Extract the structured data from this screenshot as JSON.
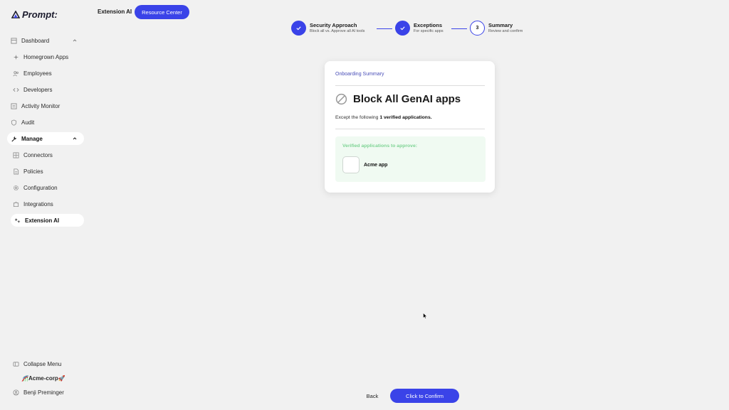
{
  "brand": {
    "name": "Prompt:"
  },
  "sidebar": {
    "items": [
      {
        "label": "Dashboard",
        "icon": "dashboard-icon",
        "expanded": true
      },
      {
        "label": "Homegrown Apps",
        "icon": "sparkle-icon"
      },
      {
        "label": "Employees",
        "icon": "users-icon"
      },
      {
        "label": "Developers",
        "icon": "code-icon"
      },
      {
        "label": "Activity Monitor",
        "icon": "monitor-icon"
      },
      {
        "label": "Audit",
        "icon": "shield-icon"
      },
      {
        "label": "Manage",
        "icon": "wrench-icon",
        "expanded": true,
        "active": true
      },
      {
        "label": "Connectors",
        "icon": "grid-icon"
      },
      {
        "label": "Policies",
        "icon": "document-icon"
      },
      {
        "label": "Configuration",
        "icon": "gear-icon"
      },
      {
        "label": "Integrations",
        "icon": "puzzle-icon"
      },
      {
        "label": "Extension AI",
        "icon": "extension-icon",
        "active": true
      }
    ],
    "footer": {
      "collapse_label": "Collapse Menu",
      "org_name": "🎢Acme-corp🚀",
      "user_name": "Benji Preminger"
    }
  },
  "header": {
    "title": "Extension AI",
    "resource_button": "Resource Center"
  },
  "stepper": {
    "steps": [
      {
        "title": "Security Approach",
        "subtitle": "Block all vs. Approve all AI tools",
        "state": "done"
      },
      {
        "title": "Exceptions",
        "subtitle": "For specific apps",
        "state": "done"
      },
      {
        "title": "Summary",
        "subtitle": "Review and confirm",
        "state": "current",
        "number": "3"
      }
    ]
  },
  "card": {
    "eyebrow": "Onboarding Summary",
    "title": "Block All GenAI apps",
    "subtitle_prefix": "Except the following ",
    "subtitle_bold": "1 verified applications.",
    "verified_label": "Verified applications to approve:",
    "apps": [
      {
        "name": "Acme app"
      }
    ]
  },
  "actions": {
    "back_label": "Back",
    "confirm_label": "Click to Confirm"
  },
  "colors": {
    "accent": "#3a43e8",
    "verified_green": "#7fd495",
    "verified_bg": "#f0faf2",
    "eyebrow": "#4a4fb8"
  }
}
